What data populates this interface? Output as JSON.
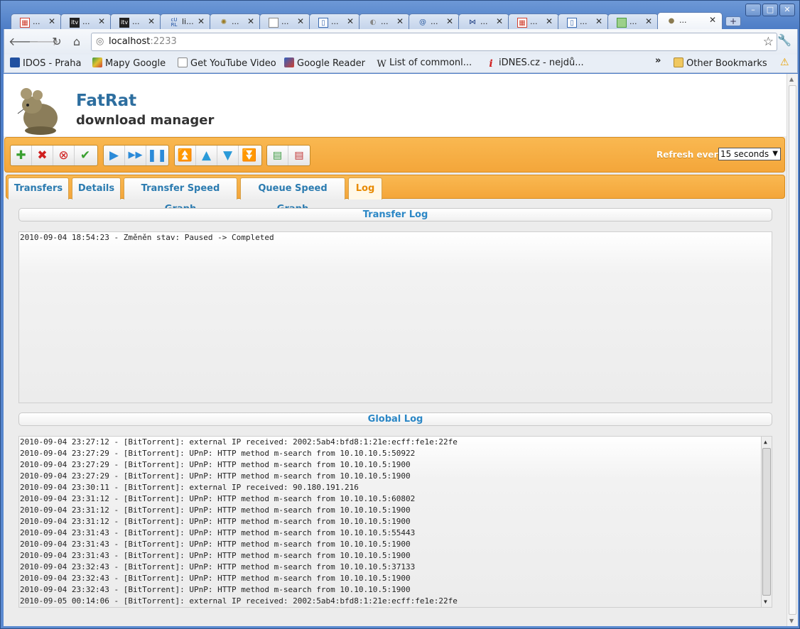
{
  "browser": {
    "tabs": [
      {
        "title": "...",
        "icon": "calendar-icon",
        "color": "#d04030"
      },
      {
        "title": "...",
        "icon": "itv-icon",
        "color": "#222222"
      },
      {
        "title": "...",
        "icon": "itv-icon",
        "color": "#222222"
      },
      {
        "title": "li...",
        "icon": "curl-icon",
        "color": "#1a4da0"
      },
      {
        "title": "...",
        "icon": "puzzle-icon",
        "color": "#9a7a20"
      },
      {
        "title": "...",
        "icon": "page-icon",
        "color": "#666666"
      },
      {
        "title": "...",
        "icon": "doc-icon",
        "color": "#3a6ab0"
      },
      {
        "title": "...",
        "icon": "globe-icon",
        "color": "#888888"
      },
      {
        "title": "...",
        "icon": "at-icon",
        "color": "#2a5aa0"
      },
      {
        "title": "...",
        "icon": "bowtie-icon",
        "color": "#1a3a80"
      },
      {
        "title": "...",
        "icon": "calendar-icon",
        "color": "#d04030"
      },
      {
        "title": "...",
        "icon": "doc-icon",
        "color": "#3a6ab0"
      },
      {
        "title": "...",
        "icon": "map-icon",
        "color": "#4a9a40"
      },
      {
        "title": "...",
        "icon": "rat-icon",
        "color": "#8a7a50"
      }
    ],
    "url_host": "localhost",
    "url_port": ":2233",
    "bookmarks": [
      {
        "label": "IDOS - Praha",
        "icon": "idos-icon",
        "color": "#2050a0"
      },
      {
        "label": "Mapy Google",
        "icon": "google-maps-icon",
        "color": "#3a9a40"
      },
      {
        "label": "Get YouTube Video",
        "icon": "page-icon",
        "color": "#888888"
      },
      {
        "label": "Google Reader",
        "icon": "reader-icon",
        "color": "#3060c0"
      },
      {
        "label": "List of commonl...",
        "icon": "wikipedia-icon",
        "color": "#222222"
      },
      {
        "label": "iDNES.cz - nejdů...",
        "icon": "idnes-icon",
        "color": "#d02020"
      }
    ],
    "other_bookmarks": "Other Bookmarks",
    "chevron": "»"
  },
  "app": {
    "title": "FatRat",
    "subtitle": "download manager"
  },
  "toolbar": {
    "refresh_label": "Refresh every",
    "refresh_value": "15 seconds"
  },
  "tabs": [
    "Transfers",
    "Details",
    "Transfer Speed Graph",
    "Queue Speed Graph",
    "Log"
  ],
  "transfer_log": {
    "title": "Transfer Log",
    "lines": [
      "2010-09-04 18:54:23 - Změněn stav: Paused -> Completed"
    ]
  },
  "global_log": {
    "title": "Global Log",
    "lines": [
      "2010-09-04 23:27:12 - [BitTorrent]: external IP received: 2002:5ab4:bfd8:1:21e:ecff:fe1e:22fe",
      "2010-09-04 23:27:29 - [BitTorrent]: UPnP: HTTP method m-search from 10.10.10.5:50922",
      "2010-09-04 23:27:29 - [BitTorrent]: UPnP: HTTP method m-search from 10.10.10.5:1900",
      "2010-09-04 23:27:29 - [BitTorrent]: UPnP: HTTP method m-search from 10.10.10.5:1900",
      "2010-09-04 23:30:11 - [BitTorrent]: external IP received: 90.180.191.216",
      "2010-09-04 23:31:12 - [BitTorrent]: UPnP: HTTP method m-search from 10.10.10.5:60802",
      "2010-09-04 23:31:12 - [BitTorrent]: UPnP: HTTP method m-search from 10.10.10.5:1900",
      "2010-09-04 23:31:12 - [BitTorrent]: UPnP: HTTP method m-search from 10.10.10.5:1900",
      "2010-09-04 23:31:43 - [BitTorrent]: UPnP: HTTP method m-search from 10.10.10.5:55443",
      "2010-09-04 23:31:43 - [BitTorrent]: UPnP: HTTP method m-search from 10.10.10.5:1900",
      "2010-09-04 23:31:43 - [BitTorrent]: UPnP: HTTP method m-search from 10.10.10.5:1900",
      "2010-09-04 23:32:43 - [BitTorrent]: UPnP: HTTP method m-search from 10.10.10.5:37133",
      "2010-09-04 23:32:43 - [BitTorrent]: UPnP: HTTP method m-search from 10.10.10.5:1900",
      "2010-09-04 23:32:43 - [BitTorrent]: UPnP: HTTP method m-search from 10.10.10.5:1900",
      "2010-09-05 00:14:06 - [BitTorrent]: external IP received: 2002:5ab4:bfd8:1:21e:ecff:fe1e:22fe"
    ]
  },
  "colors": {
    "accent_orange": "#f4a63a",
    "tab_text": "#2b7bb0",
    "active_tab_text": "#e88a00",
    "title_blue": "#2d6e9f"
  }
}
